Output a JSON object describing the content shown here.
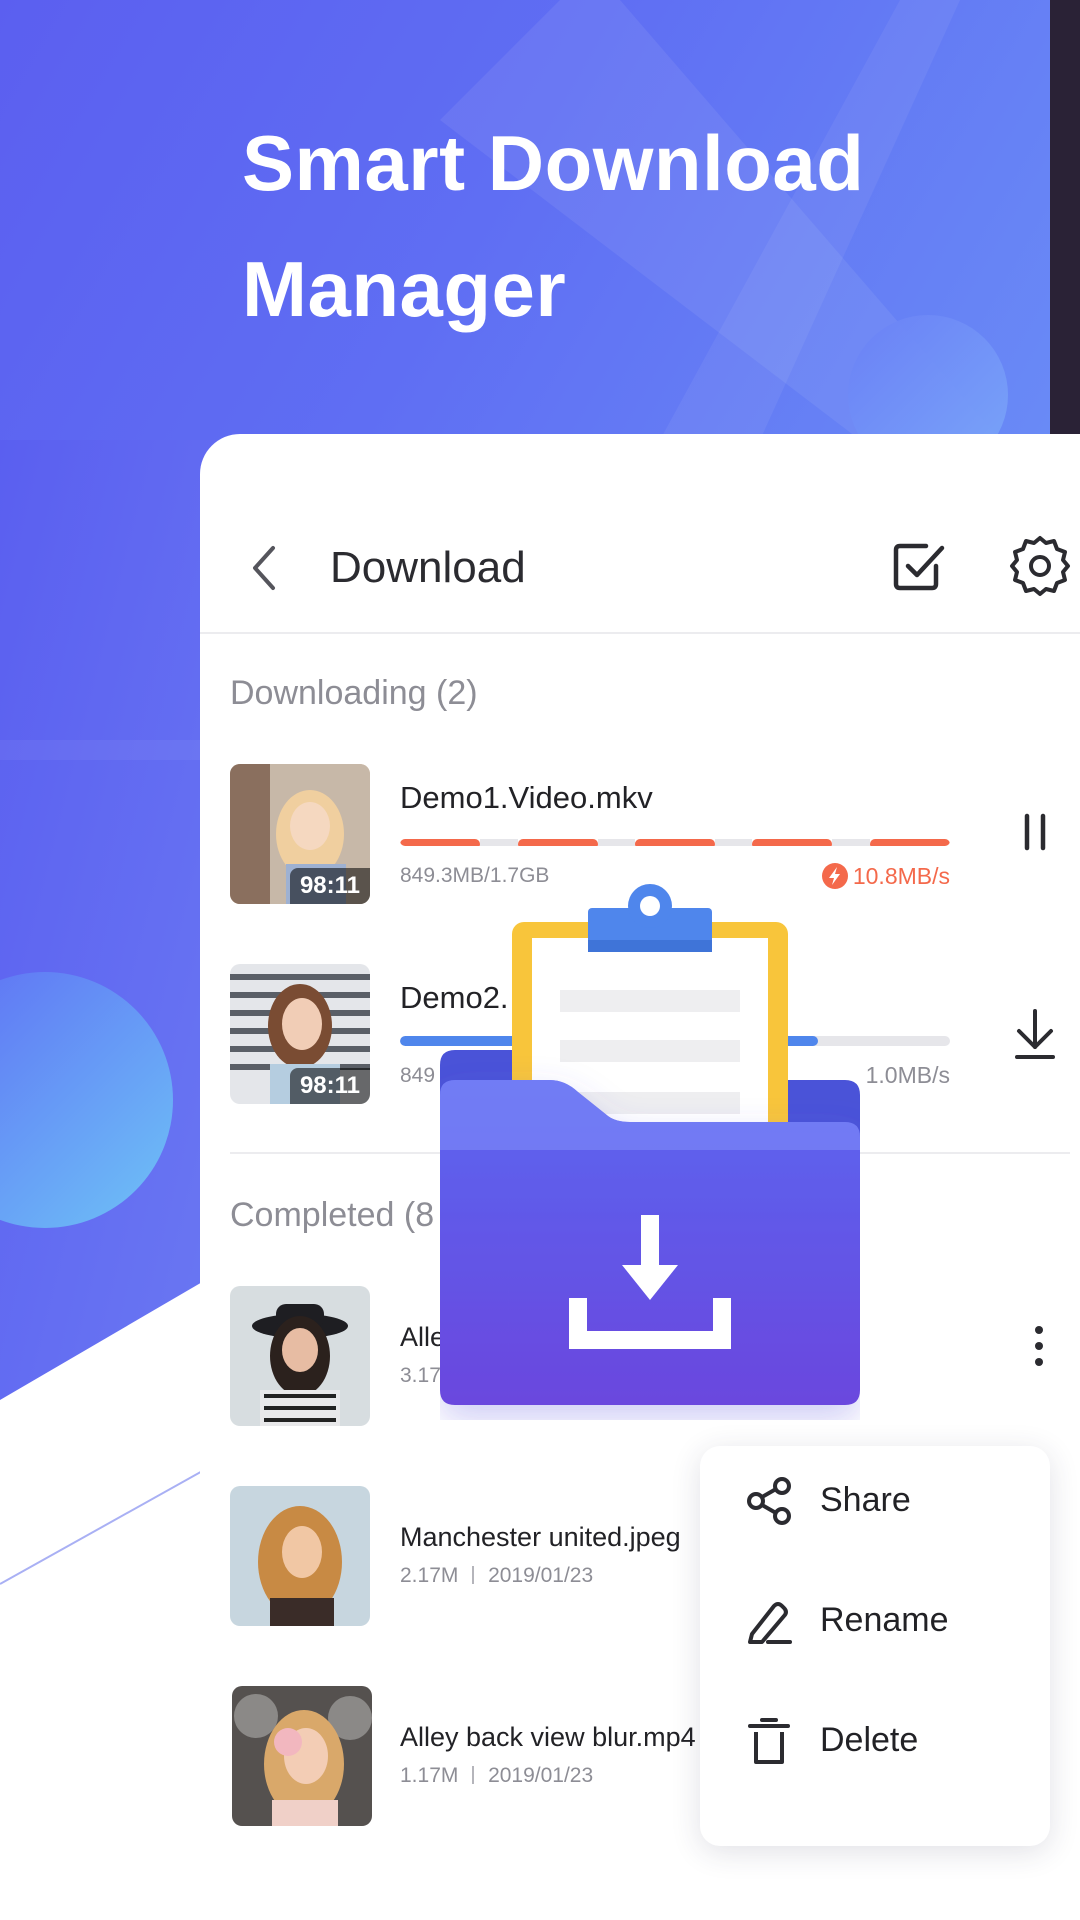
{
  "header": {
    "title_line1": "Smart Download",
    "title_line2": "Manager"
  },
  "topbar": {
    "title": "Download",
    "icons": [
      "chevron-left-icon",
      "checkbox-icon",
      "gear-icon"
    ]
  },
  "downloading": {
    "label": "Downloading (2)",
    "items": [
      {
        "name": "Demo1.Video.mkv",
        "size": "849.3MB/1.7GB",
        "speed": "10.8MB/s",
        "duration": "98:11",
        "progress": 1.0,
        "progress_style": "segmented",
        "color": "#f4694b",
        "action_icon": "pause-icon"
      },
      {
        "name": "Demo2.",
        "size": "849",
        "speed": "1.0MB/s",
        "duration": "98:11",
        "progress": 0.76,
        "progress_style": "solid",
        "color": "#4f86ec",
        "action_icon": "download-icon"
      }
    ]
  },
  "completed": {
    "label": "Completed (8",
    "items": [
      {
        "name": "Alle",
        "meta": "3.17",
        "action_icon": "more-vertical-icon"
      },
      {
        "name": "Manchester united.jpeg",
        "size": "2.17M",
        "date": "2019/01/23"
      },
      {
        "name": "Alley back view blur.mp4",
        "size": "1.17M",
        "date": "2019/01/23"
      }
    ]
  },
  "menu": {
    "items": [
      {
        "label": "Share",
        "icon": "share-icon"
      },
      {
        "label": "Rename",
        "icon": "pencil-icon"
      },
      {
        "label": "Delete",
        "icon": "trash-icon"
      }
    ]
  },
  "colors": {
    "brand": "#5b5ff0",
    "downloading_accent": "#f4694b",
    "progress_blue": "#4f86ec",
    "folder": "#5d63ea",
    "clipboard": "#f8c53b"
  }
}
